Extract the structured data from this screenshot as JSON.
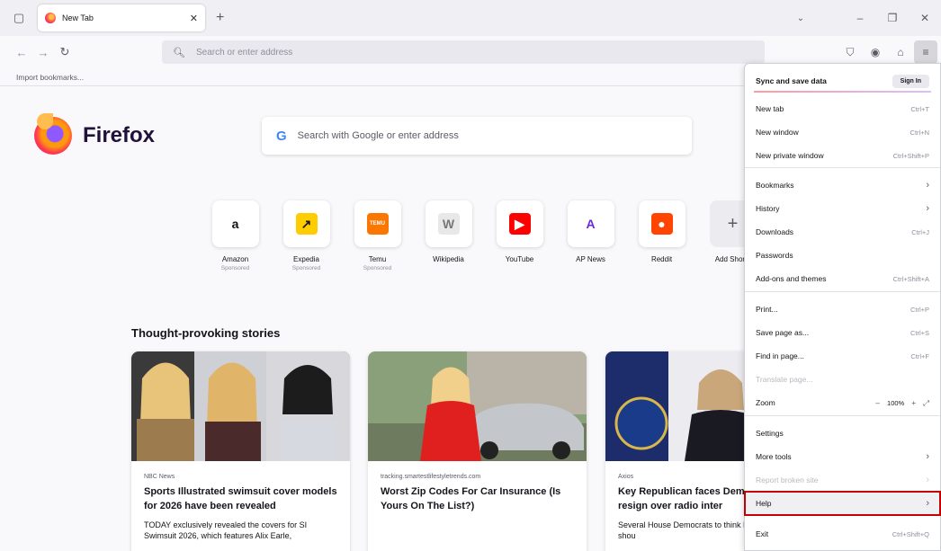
{
  "tab": {
    "title": "New Tab"
  },
  "urlbar": {
    "placeholder": "Search or enter address"
  },
  "bookmarks_bar": {
    "import_label": "Import bookmarks..."
  },
  "brand": {
    "name": "Firefox"
  },
  "search": {
    "placeholder": "Search with Google or enter address"
  },
  "shortcuts": [
    {
      "label": "Amazon",
      "sponsored": "Sponsored",
      "glyph": "a",
      "icon": "amazon-icon",
      "bg": "#ffffff",
      "fg": "#111111"
    },
    {
      "label": "Expedia",
      "sponsored": "Sponsored",
      "glyph": "↗",
      "icon": "expedia-icon",
      "bg": "#ffcc00",
      "fg": "#1a1a1a"
    },
    {
      "label": "Temu",
      "sponsored": "Sponsored",
      "glyph": "TEMU",
      "icon": "temu-icon",
      "bg": "#fb7701",
      "fg": "#ffffff"
    },
    {
      "label": "Wikipedia",
      "sponsored": "",
      "glyph": "W",
      "icon": "wikipedia-icon",
      "bg": "#e8e8e8",
      "fg": "#777777"
    },
    {
      "label": "YouTube",
      "sponsored": "",
      "glyph": "▶",
      "icon": "youtube-icon",
      "bg": "#ff0000",
      "fg": "#ffffff"
    },
    {
      "label": "AP News",
      "sponsored": "",
      "glyph": "A",
      "icon": "ap-news-icon",
      "bg": "#ffffff",
      "fg": "#6b2ad8"
    },
    {
      "label": "Reddit",
      "sponsored": "",
      "glyph": "●",
      "icon": "reddit-icon",
      "bg": "#ff4500",
      "fg": "#ffffff"
    },
    {
      "label": "Add Shortc",
      "sponsored": "",
      "glyph": "+",
      "icon": "plus-icon",
      "bg": "",
      "fg": ""
    }
  ],
  "stories": {
    "title": "Thought-provoking stories",
    "cards": [
      {
        "source": "NBC News",
        "headline": "Sports Illustrated swimsuit cover models for 2026 have been revealed",
        "excerpt": "TODAY exclusively revealed the covers for SI Swimsuit 2026, which features Alix Earle,"
      },
      {
        "source": "tracking.smartestlifestyletrends.com",
        "headline": "Worst Zip Codes For Car Insurance (Is Yours On The List?)",
        "excerpt": ""
      },
      {
        "source": "Axios",
        "headline": "Key Republican faces Dem calls to resign over radio inter",
        "excerpt": "Several House Democrats to think Rep. Jen Kiggans shou"
      }
    ]
  },
  "menu": {
    "sync_title": "Sync and save data",
    "sign_in": "Sign In",
    "items": [
      {
        "label": "New tab",
        "shortcut": "Ctrl+T"
      },
      {
        "label": "New window",
        "shortcut": "Ctrl+N"
      },
      {
        "label": "New private window",
        "shortcut": "Ctrl+Shift+P"
      },
      {
        "label": "Bookmarks",
        "shortcut": ""
      },
      {
        "label": "History",
        "shortcut": ""
      },
      {
        "label": "Downloads",
        "shortcut": "Ctrl+J"
      },
      {
        "label": "Passwords",
        "shortcut": ""
      },
      {
        "label": "Add-ons and themes",
        "shortcut": "Ctrl+Shift+A"
      },
      {
        "label": "Print...",
        "shortcut": "Ctrl+P"
      },
      {
        "label": "Save page as...",
        "shortcut": "Ctrl+S"
      },
      {
        "label": "Find in page...",
        "shortcut": "Ctrl+F"
      },
      {
        "label": "Translate page...",
        "shortcut": ""
      },
      {
        "label": "Zoom",
        "shortcut": ""
      },
      {
        "label": "Settings",
        "shortcut": ""
      },
      {
        "label": "More tools",
        "shortcut": ""
      },
      {
        "label": "Report broken site",
        "shortcut": ""
      },
      {
        "label": "Help",
        "shortcut": ""
      },
      {
        "label": "Exit",
        "shortcut": "Ctrl+Shift+Q"
      }
    ],
    "zoom": {
      "minus": "–",
      "value": "100%",
      "plus": "+"
    }
  }
}
